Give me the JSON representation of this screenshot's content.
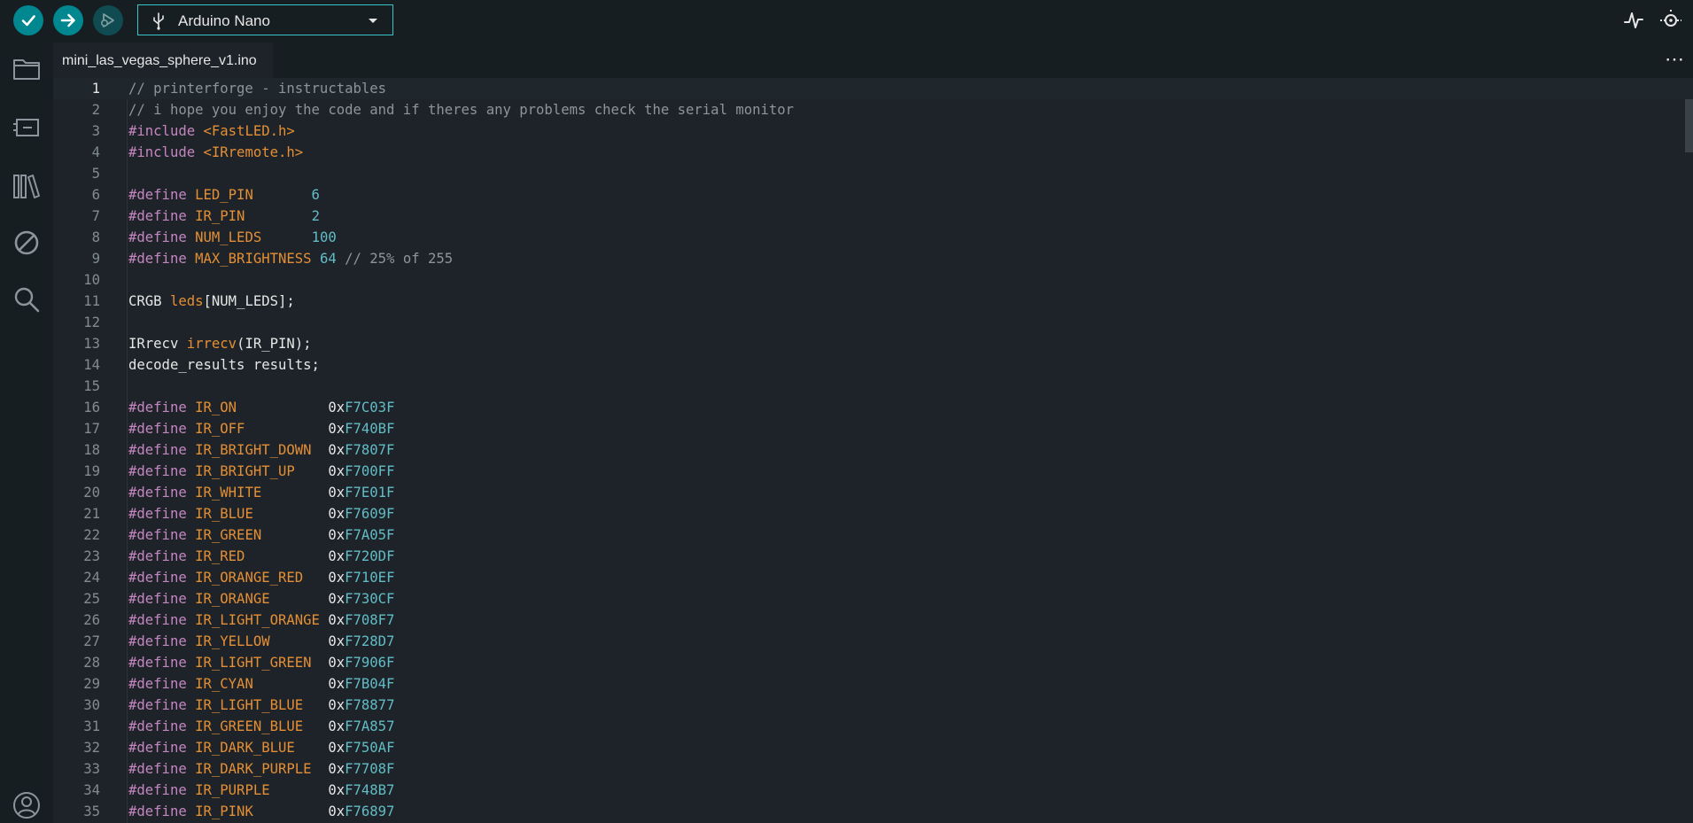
{
  "toolbar": {
    "board": "Arduino Nano",
    "verify_icon": "check-icon",
    "upload_icon": "arrow-right-icon",
    "debug_icon": "debug-icon",
    "plotter_icon": "serial-plotter-icon",
    "monitor_icon": "serial-monitor-icon"
  },
  "sidebar": {
    "items": [
      "folder-icon",
      "board-icon",
      "library-icon",
      "debug-off-icon",
      "search-icon",
      "account-icon"
    ]
  },
  "tabs": [
    {
      "label": "mini_las_vegas_sphere_v1.ino",
      "active": true
    }
  ],
  "editor": {
    "active_line": 1,
    "lines": [
      {
        "n": "1",
        "tokens": [
          {
            "t": "// printerforge - instructables",
            "c": "comment"
          }
        ]
      },
      {
        "n": "2",
        "tokens": [
          {
            "t": "// i hope you enjoy the code and if theres any problems check the serial monitor",
            "c": "comment"
          }
        ]
      },
      {
        "n": "3",
        "tokens": [
          {
            "t": "#include ",
            "c": "kw"
          },
          {
            "t": "<FastLED.h>",
            "c": "def"
          }
        ]
      },
      {
        "n": "4",
        "tokens": [
          {
            "t": "#include ",
            "c": "kw"
          },
          {
            "t": "<IRremote.h>",
            "c": "def"
          }
        ]
      },
      {
        "n": "5",
        "tokens": []
      },
      {
        "n": "6",
        "tokens": [
          {
            "t": "#define ",
            "c": "kw"
          },
          {
            "t": "LED_PIN",
            "c": "def"
          },
          {
            "t": "       ",
            "c": "plain"
          },
          {
            "t": "6",
            "c": "num"
          }
        ]
      },
      {
        "n": "7",
        "tokens": [
          {
            "t": "#define ",
            "c": "kw"
          },
          {
            "t": "IR_PIN",
            "c": "def"
          },
          {
            "t": "        ",
            "c": "plain"
          },
          {
            "t": "2",
            "c": "num"
          }
        ]
      },
      {
        "n": "8",
        "tokens": [
          {
            "t": "#define ",
            "c": "kw"
          },
          {
            "t": "NUM_LEDS",
            "c": "def"
          },
          {
            "t": "      ",
            "c": "plain"
          },
          {
            "t": "100",
            "c": "num"
          }
        ]
      },
      {
        "n": "9",
        "tokens": [
          {
            "t": "#define ",
            "c": "kw"
          },
          {
            "t": "MAX_BRIGHTNESS",
            "c": "def"
          },
          {
            "t": " ",
            "c": "plain"
          },
          {
            "t": "64",
            "c": "num"
          },
          {
            "t": " // 25% of 255",
            "c": "comment"
          }
        ]
      },
      {
        "n": "10",
        "tokens": []
      },
      {
        "n": "11",
        "tokens": [
          {
            "t": "CRGB ",
            "c": "plain"
          },
          {
            "t": "leds",
            "c": "def"
          },
          {
            "t": "[NUM_LEDS];",
            "c": "plain"
          }
        ]
      },
      {
        "n": "12",
        "tokens": []
      },
      {
        "n": "13",
        "tokens": [
          {
            "t": "IRrecv ",
            "c": "plain"
          },
          {
            "t": "irrecv",
            "c": "def"
          },
          {
            "t": "(IR_PIN);",
            "c": "plain"
          }
        ]
      },
      {
        "n": "14",
        "tokens": [
          {
            "t": "decode_results results;",
            "c": "plain"
          }
        ]
      },
      {
        "n": "15",
        "tokens": []
      },
      {
        "n": "16",
        "tokens": [
          {
            "t": "#define ",
            "c": "kw"
          },
          {
            "t": "IR_ON",
            "c": "def"
          },
          {
            "t": "           0x",
            "c": "plain"
          },
          {
            "t": "F7C03F",
            "c": "num"
          }
        ]
      },
      {
        "n": "17",
        "tokens": [
          {
            "t": "#define ",
            "c": "kw"
          },
          {
            "t": "IR_OFF",
            "c": "def"
          },
          {
            "t": "          0x",
            "c": "plain"
          },
          {
            "t": "F740BF",
            "c": "num"
          }
        ]
      },
      {
        "n": "18",
        "tokens": [
          {
            "t": "#define ",
            "c": "kw"
          },
          {
            "t": "IR_BRIGHT_DOWN",
            "c": "def"
          },
          {
            "t": "  0x",
            "c": "plain"
          },
          {
            "t": "F7807F",
            "c": "num"
          }
        ]
      },
      {
        "n": "19",
        "tokens": [
          {
            "t": "#define ",
            "c": "kw"
          },
          {
            "t": "IR_BRIGHT_UP",
            "c": "def"
          },
          {
            "t": "    0x",
            "c": "plain"
          },
          {
            "t": "F700FF",
            "c": "num"
          }
        ]
      },
      {
        "n": "20",
        "tokens": [
          {
            "t": "#define ",
            "c": "kw"
          },
          {
            "t": "IR_WHITE",
            "c": "def"
          },
          {
            "t": "        0x",
            "c": "plain"
          },
          {
            "t": "F7E01F",
            "c": "num"
          }
        ]
      },
      {
        "n": "21",
        "tokens": [
          {
            "t": "#define ",
            "c": "kw"
          },
          {
            "t": "IR_BLUE",
            "c": "def"
          },
          {
            "t": "         0x",
            "c": "plain"
          },
          {
            "t": "F7609F",
            "c": "num"
          }
        ]
      },
      {
        "n": "22",
        "tokens": [
          {
            "t": "#define ",
            "c": "kw"
          },
          {
            "t": "IR_GREEN",
            "c": "def"
          },
          {
            "t": "        0x",
            "c": "plain"
          },
          {
            "t": "F7A05F",
            "c": "num"
          }
        ]
      },
      {
        "n": "23",
        "tokens": [
          {
            "t": "#define ",
            "c": "kw"
          },
          {
            "t": "IR_RED",
            "c": "def"
          },
          {
            "t": "          0x",
            "c": "plain"
          },
          {
            "t": "F720DF",
            "c": "num"
          }
        ]
      },
      {
        "n": "24",
        "tokens": [
          {
            "t": "#define ",
            "c": "kw"
          },
          {
            "t": "IR_ORANGE_RED",
            "c": "def"
          },
          {
            "t": "   0x",
            "c": "plain"
          },
          {
            "t": "F710EF",
            "c": "num"
          }
        ]
      },
      {
        "n": "25",
        "tokens": [
          {
            "t": "#define ",
            "c": "kw"
          },
          {
            "t": "IR_ORANGE",
            "c": "def"
          },
          {
            "t": "       0x",
            "c": "plain"
          },
          {
            "t": "F730CF",
            "c": "num"
          }
        ]
      },
      {
        "n": "26",
        "tokens": [
          {
            "t": "#define ",
            "c": "kw"
          },
          {
            "t": "IR_LIGHT_ORANGE",
            "c": "def"
          },
          {
            "t": " 0x",
            "c": "plain"
          },
          {
            "t": "F708F7",
            "c": "num"
          }
        ]
      },
      {
        "n": "27",
        "tokens": [
          {
            "t": "#define ",
            "c": "kw"
          },
          {
            "t": "IR_YELLOW",
            "c": "def"
          },
          {
            "t": "       0x",
            "c": "plain"
          },
          {
            "t": "F728D7",
            "c": "num"
          }
        ]
      },
      {
        "n": "28",
        "tokens": [
          {
            "t": "#define ",
            "c": "kw"
          },
          {
            "t": "IR_LIGHT_GREEN",
            "c": "def"
          },
          {
            "t": "  0x",
            "c": "plain"
          },
          {
            "t": "F7906F",
            "c": "num"
          }
        ]
      },
      {
        "n": "29",
        "tokens": [
          {
            "t": "#define ",
            "c": "kw"
          },
          {
            "t": "IR_CYAN",
            "c": "def"
          },
          {
            "t": "         0x",
            "c": "plain"
          },
          {
            "t": "F7B04F",
            "c": "num"
          }
        ]
      },
      {
        "n": "30",
        "tokens": [
          {
            "t": "#define ",
            "c": "kw"
          },
          {
            "t": "IR_LIGHT_BLUE",
            "c": "def"
          },
          {
            "t": "   0x",
            "c": "plain"
          },
          {
            "t": "F78877",
            "c": "num"
          }
        ]
      },
      {
        "n": "31",
        "tokens": [
          {
            "t": "#define ",
            "c": "kw"
          },
          {
            "t": "IR_GREEN_BLUE",
            "c": "def"
          },
          {
            "t": "   0x",
            "c": "plain"
          },
          {
            "t": "F7A857",
            "c": "num"
          }
        ]
      },
      {
        "n": "32",
        "tokens": [
          {
            "t": "#define ",
            "c": "kw"
          },
          {
            "t": "IR_DARK_BLUE",
            "c": "def"
          },
          {
            "t": "    0x",
            "c": "plain"
          },
          {
            "t": "F750AF",
            "c": "num"
          }
        ]
      },
      {
        "n": "33",
        "tokens": [
          {
            "t": "#define ",
            "c": "kw"
          },
          {
            "t": "IR_DARK_PURPLE",
            "c": "def"
          },
          {
            "t": "  0x",
            "c": "plain"
          },
          {
            "t": "F7708F",
            "c": "num"
          }
        ]
      },
      {
        "n": "34",
        "tokens": [
          {
            "t": "#define ",
            "c": "kw"
          },
          {
            "t": "IR_PURPLE",
            "c": "def"
          },
          {
            "t": "       0x",
            "c": "plain"
          },
          {
            "t": "F748B7",
            "c": "num"
          }
        ]
      },
      {
        "n": "35",
        "tokens": [
          {
            "t": "#define ",
            "c": "kw"
          },
          {
            "t": "IR_PINK",
            "c": "def"
          },
          {
            "t": "         0x",
            "c": "plain"
          },
          {
            "t": "F76897",
            "c": "num"
          }
        ]
      }
    ]
  }
}
